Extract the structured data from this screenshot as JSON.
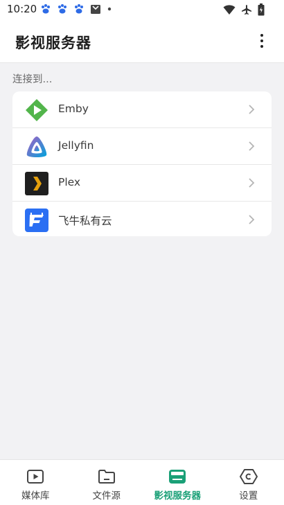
{
  "status_bar": {
    "time": "10:20",
    "left_icons": [
      "baidu-paw-icon",
      "baidu-paw-icon",
      "baidu-paw-icon",
      "notification-bag-icon",
      "dot-icon"
    ],
    "right_icons": [
      "wifi-icon",
      "airplane-icon",
      "battery-icon"
    ]
  },
  "app_bar": {
    "title": "影视服务器",
    "menu_icon": "more-vertical-icon"
  },
  "content": {
    "section_label": "连接到...",
    "servers": [
      {
        "name": "Emby",
        "icon": "emby-logo",
        "color": "#52b54b"
      },
      {
        "name": "Jellyfin",
        "icon": "jellyfin-logo",
        "color": "#aa5cc3"
      },
      {
        "name": "Plex",
        "icon": "plex-logo",
        "color": "#e5a00d"
      },
      {
        "name": "飞牛私有云",
        "icon": "fnos-logo",
        "color": "#2b6ff3"
      }
    ]
  },
  "bottom_nav": {
    "active_color": "#1aa077",
    "items": [
      {
        "label": "媒体库",
        "icon": "play-box-icon",
        "active": false
      },
      {
        "label": "文件源",
        "icon": "folder-icon",
        "active": false
      },
      {
        "label": "影视服务器",
        "icon": "server-icon",
        "active": true
      },
      {
        "label": "设置",
        "icon": "settings-hexagon-icon",
        "active": false
      }
    ]
  }
}
